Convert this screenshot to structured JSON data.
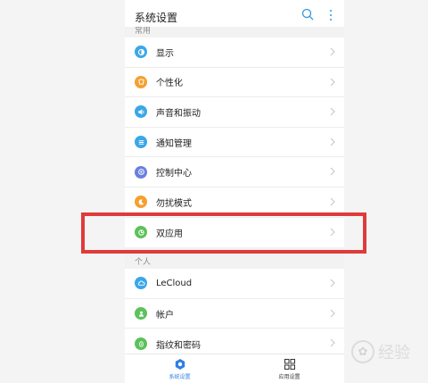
{
  "header": {
    "title": "系统设置"
  },
  "sections": [
    {
      "header": "常用",
      "items": [
        {
          "label": "显示",
          "icon": "display-icon",
          "color": "#3aa7e8"
        },
        {
          "label": "个性化",
          "icon": "personalize-icon",
          "color": "#f5a030"
        },
        {
          "label": "声音和振动",
          "icon": "sound-icon",
          "color": "#3aa7e8"
        },
        {
          "label": "通知管理",
          "icon": "notification-icon",
          "color": "#3aa7e8"
        },
        {
          "label": "控制中心",
          "icon": "control-center-icon",
          "color": "#6a7fe0"
        },
        {
          "label": "勿扰模式",
          "icon": "dnd-icon",
          "color": "#f5a030"
        },
        {
          "label": "双应用",
          "icon": "dual-app-icon",
          "color": "#5cc25a"
        }
      ]
    },
    {
      "header": "个人",
      "items": [
        {
          "label": "LeCloud",
          "icon": "cloud-icon",
          "color": "#3aa7e8"
        },
        {
          "label": "帐户",
          "icon": "account-icon",
          "color": "#5cc25a"
        },
        {
          "label": "指纹和密码",
          "icon": "fingerprint-icon",
          "color": "#5cc25a"
        }
      ]
    }
  ],
  "bottom_nav": [
    {
      "label": "系统设置",
      "icon": "settings-icon",
      "active": true,
      "color": "#2f7fe0"
    },
    {
      "label": "应用设置",
      "icon": "apps-grid-icon",
      "active": false,
      "color": "#333333"
    }
  ],
  "watermark": {
    "text": "经验"
  },
  "colors": {
    "highlight": "#e03a3a",
    "accent": "#2f7fe0"
  }
}
